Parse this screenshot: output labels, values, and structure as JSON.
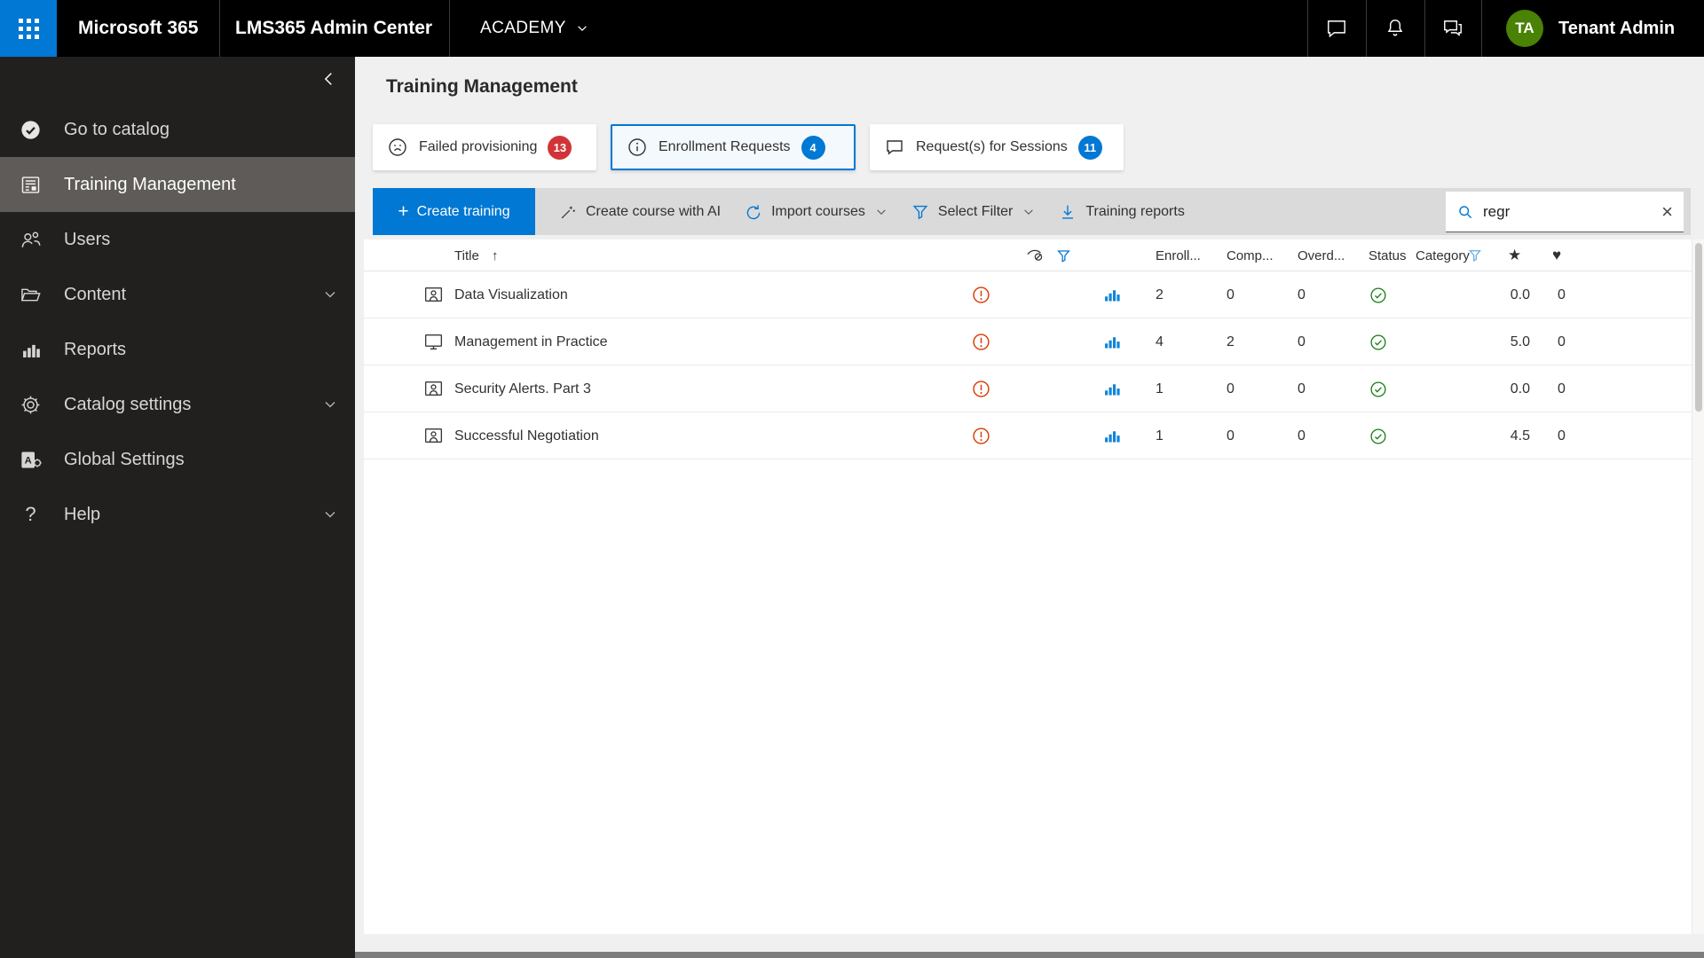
{
  "topbar": {
    "brand": "Microsoft 365",
    "app_title": "LMS365 Admin Center",
    "tenant": "ACADEMY",
    "user_initials": "TA",
    "user_name": "Tenant Admin"
  },
  "sidebar": {
    "items": [
      {
        "label": "Go to catalog",
        "icon": "check-circle-icon",
        "selected": false
      },
      {
        "label": "Training Management",
        "icon": "document-icon",
        "selected": true
      },
      {
        "label": "Users",
        "icon": "people-icon",
        "selected": false
      },
      {
        "label": "Content",
        "icon": "folder-icon",
        "selected": false,
        "expandable": true
      },
      {
        "label": "Reports",
        "icon": "bar-chart-icon",
        "selected": false
      },
      {
        "label": "Catalog settings",
        "icon": "gear-icon",
        "selected": false,
        "expandable": true
      },
      {
        "label": "Global Settings",
        "icon": "admin-app-icon",
        "selected": false
      },
      {
        "label": "Help",
        "icon": "question-icon",
        "selected": false,
        "expandable": true
      }
    ]
  },
  "page_title": "Training Management",
  "tabs": [
    {
      "label": "Failed provisioning",
      "count": "13",
      "icon": "sad-face-icon",
      "badge_color": "#d13438",
      "selected": false
    },
    {
      "label": "Enrollment Requests",
      "count": "4",
      "icon": "info-icon",
      "badge_color": "#0078d4",
      "selected": true
    },
    {
      "label": "Request(s) for Sessions",
      "count": "11",
      "icon": "chat-bubble-icon",
      "badge_color": "#0078d4",
      "selected": false
    }
  ],
  "toolbar": {
    "create_training": "Create training",
    "create_course_ai": "Create course with AI",
    "import_courses": "Import courses",
    "select_filter": "Select Filter",
    "training_reports": "Training reports"
  },
  "search": {
    "value": "regr"
  },
  "table": {
    "header": {
      "title": "Title",
      "enrolled": "Enroll...",
      "completed": "Comp...",
      "overdue": "Overd...",
      "status": "Status",
      "category": "Category"
    },
    "rows": [
      {
        "title": "Data Visualization",
        "type": "instructor-led",
        "enrolled": "2",
        "completed": "0",
        "overdue": "0",
        "status": "ok",
        "category": "",
        "rating": "0.0",
        "likes": "0"
      },
      {
        "title": "Management in Practice",
        "type": "e-learning",
        "enrolled": "4",
        "completed": "2",
        "overdue": "0",
        "status": "ok",
        "category": "",
        "rating": "5.0",
        "likes": "0"
      },
      {
        "title": "Security Alerts. Part 3",
        "type": "instructor-led",
        "enrolled": "1",
        "completed": "0",
        "overdue": "0",
        "status": "ok",
        "category": "",
        "rating": "0.0",
        "likes": "0"
      },
      {
        "title": "Successful Negotiation",
        "type": "instructor-led",
        "enrolled": "1",
        "completed": "0",
        "overdue": "0",
        "status": "ok",
        "category": "",
        "rating": "4.5",
        "likes": "0"
      }
    ]
  },
  "glyphs": {
    "plus": "+",
    "sort_asc": "↑",
    "star": "★",
    "heart": "♥",
    "close": "×",
    "help": "?"
  },
  "colors": {
    "accent_blue": "#0078d4",
    "badge_red": "#d13438",
    "alert_orange": "#d83b01",
    "success_green": "#107c10",
    "avatar_green": "#498205",
    "topbar_bg": "#000000",
    "sidebar_bg": "#21201f",
    "sidebar_selected": "#5e5b58",
    "toolbar_bg": "#dadada",
    "selected_tab_bg": "#f3f9fd"
  }
}
